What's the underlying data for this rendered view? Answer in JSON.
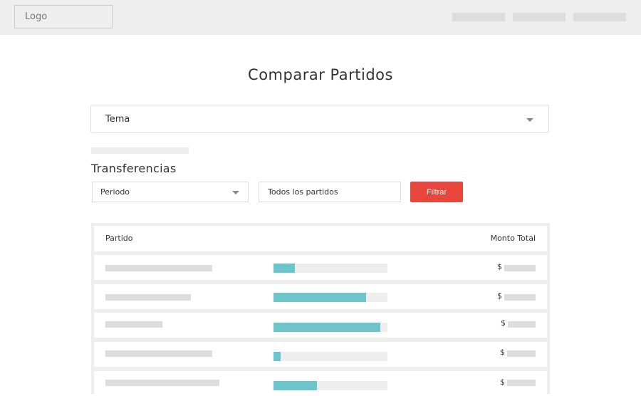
{
  "header": {
    "logo_text": "Logo",
    "nav_items": [
      "",
      "",
      ""
    ]
  },
  "page": {
    "title": "Comparar Partidos"
  },
  "topic_select": {
    "value": "Tema"
  },
  "section": {
    "title": "Transferencias"
  },
  "filters": {
    "period_select": "Periodo",
    "party_input": "Todos los partidos",
    "filter_button": "Filtrar"
  },
  "table": {
    "headers": {
      "party": "Partido",
      "total": "Monto Total"
    },
    "currency_symbol": "$",
    "rows": [
      {
        "bar_fraction": 0.19
      },
      {
        "bar_fraction": 0.81
      },
      {
        "bar_fraction": 0.94
      },
      {
        "bar_fraction": 0.06
      },
      {
        "bar_fraction": 0.38
      }
    ]
  },
  "colors": {
    "header_bg": "#eeeeee",
    "accent_red": "#e8463c",
    "bar_teal": "#6cc5ca",
    "placeholder": "#dddddd"
  }
}
